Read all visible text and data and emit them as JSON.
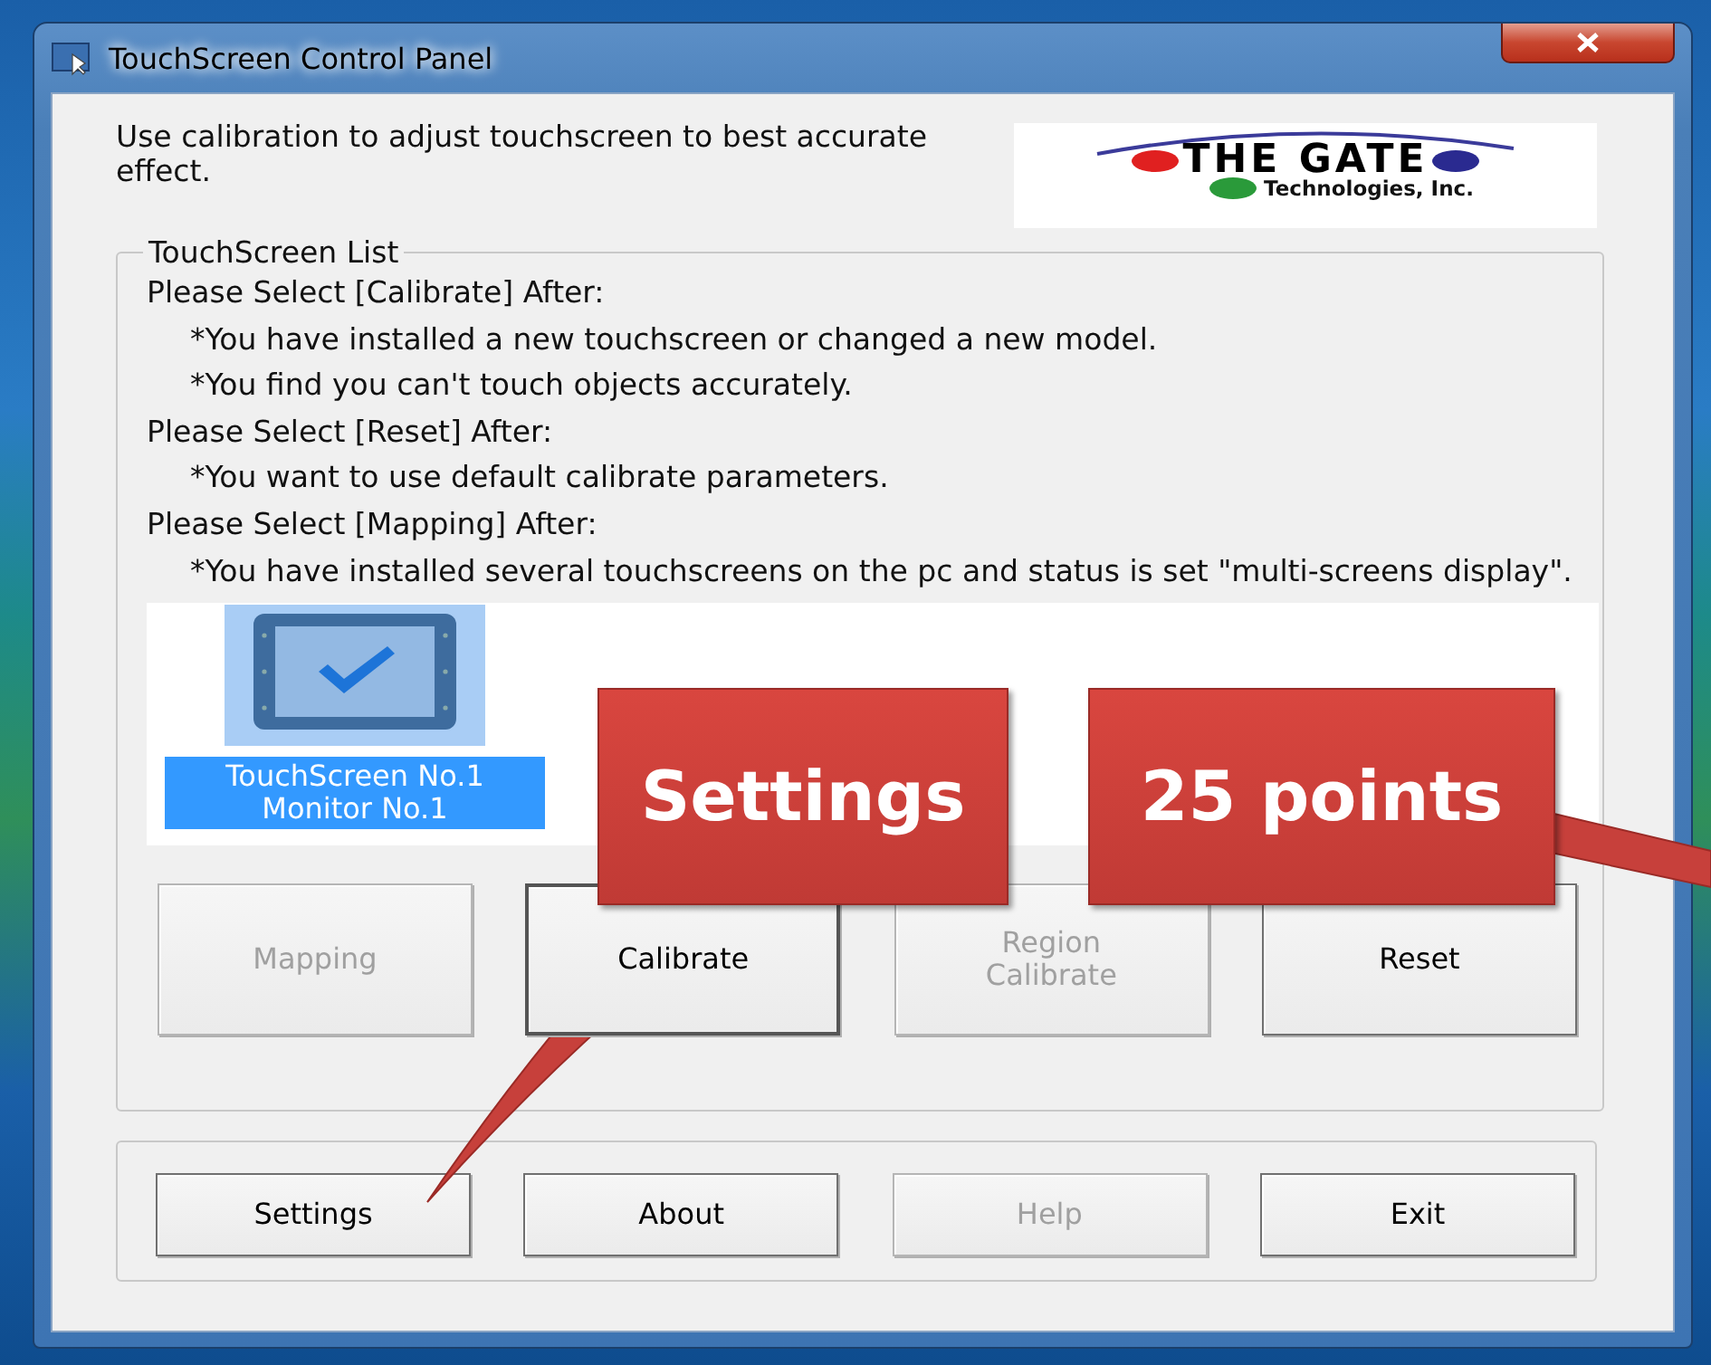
{
  "window": {
    "title": "TouchScreen Control Panel"
  },
  "intro": "Use calibration to adjust touchscreen to best accurate effect.",
  "logo": {
    "title": "THE GATE",
    "subtitle": "Technologies, Inc."
  },
  "list_group": {
    "title": "TouchScreen List",
    "instructions": [
      {
        "kind": "heading",
        "text": "Please Select [Calibrate] After:"
      },
      {
        "kind": "bullet",
        "text": "*You have installed a new touchscreen or changed a new model."
      },
      {
        "kind": "bullet",
        "text": "*You find you can't touch objects accurately."
      },
      {
        "kind": "heading",
        "text": "Please Select [Reset] After:"
      },
      {
        "kind": "bullet",
        "text": "*You want to use default calibrate parameters."
      },
      {
        "kind": "heading",
        "text": "Please Select [Mapping] After:"
      },
      {
        "kind": "bullet",
        "text": "*You have installed several touchscreens on the pc and status is set \"multi-screens display\"."
      }
    ],
    "devices": [
      {
        "lines": [
          "TouchScreen No.1",
          "Monitor No.1"
        ],
        "selected": true
      }
    ],
    "buttons": [
      {
        "lines": [
          "Mapping"
        ],
        "disabled": true
      },
      {
        "lines": [
          "Calibrate"
        ],
        "disabled": false
      },
      {
        "lines": [
          "Region",
          "Calibrate"
        ],
        "disabled": true
      },
      {
        "lines": [
          "Reset"
        ],
        "disabled": false
      }
    ]
  },
  "bottom_buttons": [
    {
      "label": "Settings",
      "disabled": false
    },
    {
      "label": "About",
      "disabled": false
    },
    {
      "label": "Help",
      "disabled": true
    },
    {
      "label": "Exit",
      "disabled": false
    }
  ],
  "callouts": [
    {
      "text": "Settings"
    },
    {
      "text": "25 points"
    }
  ]
}
